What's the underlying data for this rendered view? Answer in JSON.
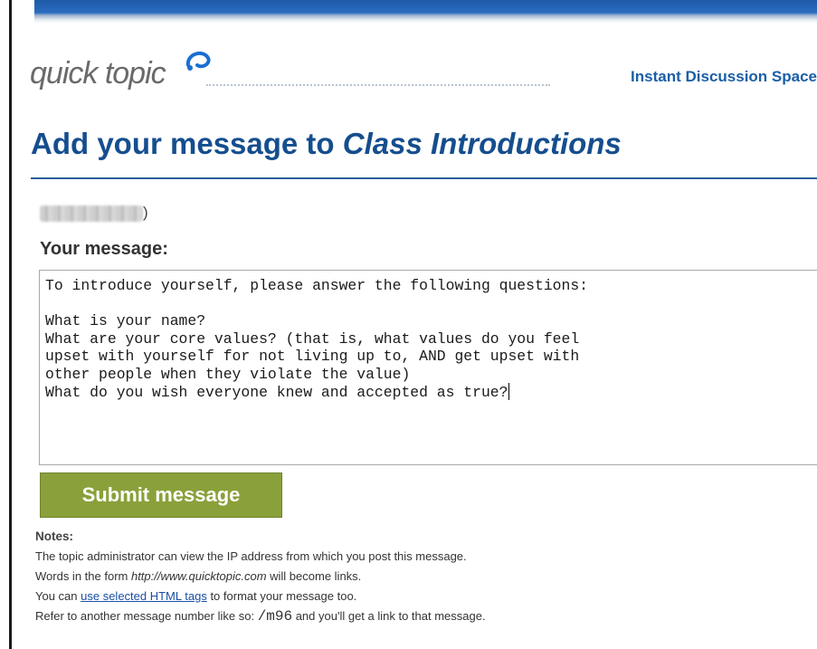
{
  "brand": {
    "logo_text": "quick topic",
    "tagline": "Instant Discussion Space"
  },
  "page": {
    "title_prefix": "Add your message to ",
    "topic_name": "Class Introductions"
  },
  "author": {
    "blurred_suffix": ")"
  },
  "form": {
    "message_label": "Your message:",
    "message_value": "To introduce yourself, please answer the following questions:\n\nWhat is your name?\nWhat are your core values? (that is, what values do you feel\nupset with yourself for not living up to, AND get upset with\nother people when they violate the value)\nWhat do you wish everyone knew and accepted as true?",
    "submit_label": "Submit message"
  },
  "notes": {
    "title": "Notes:",
    "line1": "The topic administrator can view the IP address from which you post this message.",
    "line2_prefix": "Words in the form ",
    "line2_example": "http://www.quicktopic.com",
    "line2_suffix": " will become links.",
    "line3_prefix": "You can ",
    "line3_link": "use selected HTML tags",
    "line3_suffix": " to format your message too.",
    "line4_prefix": "Refer to another message number like so: ",
    "line4_code": "/m96",
    "line4_suffix": " and you'll get a link to that message."
  },
  "colors": {
    "brand_blue": "#154e8e",
    "tagline_blue": "#1a5fa6",
    "submit_green": "#8aa03a",
    "link_blue": "#1a4fa6"
  },
  "icons": {
    "logo_mark": "swirl-logo-icon"
  }
}
